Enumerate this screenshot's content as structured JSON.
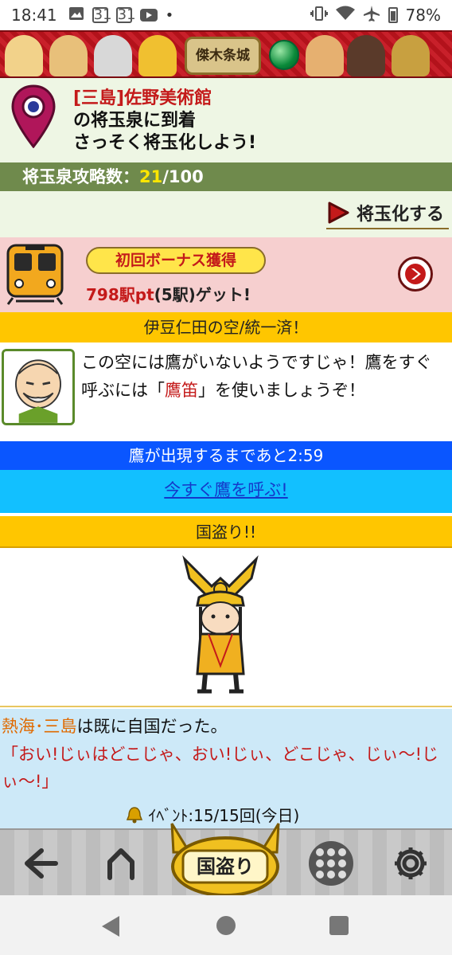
{
  "status_bar": {
    "time": "18:41",
    "calendar_day_1": "31",
    "calendar_day_2": "31",
    "dot": "•",
    "battery": "78%"
  },
  "banner": {
    "logo_text": "傑木条城"
  },
  "arrival": {
    "station": "[三島]佐野美術館",
    "line2": "の将玉泉に到着",
    "line3": "さっそく将玉化しよう!"
  },
  "capture": {
    "label": "将玉泉攻略数：",
    "count": "21",
    "total": "/100"
  },
  "actions": {
    "shogyoku_label": "将玉化する"
  },
  "bonus": {
    "title": "初回ボーナス獲得",
    "points": "798駅pt",
    "detail": "(5駅)ゲット!"
  },
  "sky": {
    "label": "伊豆仁田の空/統一済！"
  },
  "hawk_message": {
    "part1": "この空には鷹がいないようですじゃ！鷹をすぐ呼ぶには「",
    "highlight": "鷹笛",
    "part2": "」を使いましょうぞ！"
  },
  "timer": {
    "label": "鷹が出現するまであと2:59"
  },
  "call_link": {
    "label": "今すぐ鷹を呼ぶ!"
  },
  "kunitori": {
    "header": "国盗り!!"
  },
  "result": {
    "place": "熱海･三島",
    "line1_rest": "は既に自国だった。",
    "quote": "「おい!じぃはどこじゃ、おい!じぃ、どこじゃ、じぃ〜!じぃ〜!」",
    "event_label": "ｲﾍﾞﾝﾄ",
    "event_value": ":15/15回(今日)"
  },
  "bottom_nav": {
    "kunitori_label": "国盗り"
  },
  "colors": {
    "accent_red": "#c41a1a",
    "olive": "#6f8a4c",
    "gold": "#ffc600",
    "blue": "#0a56ff",
    "cyan": "#12c0ff"
  }
}
